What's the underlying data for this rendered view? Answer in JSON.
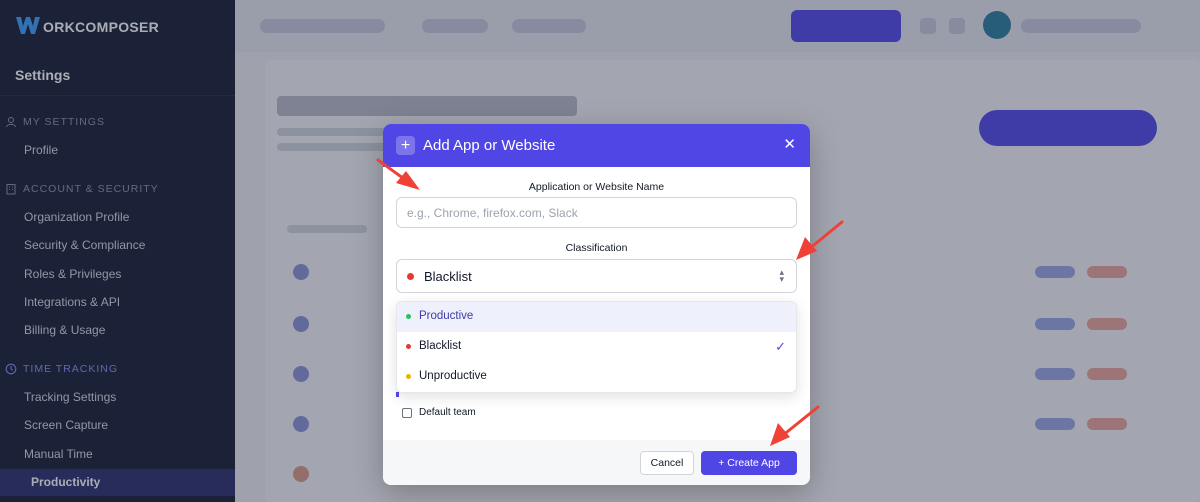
{
  "brand": {
    "logo_text": "ORKCOMPOSER",
    "logo_icon": "w-logo-icon"
  },
  "sidebar": {
    "title": "Settings",
    "sections": [
      {
        "label": "MY SETTINGS",
        "icon": "user-icon",
        "items": [
          "Profile"
        ]
      },
      {
        "label": "ACCOUNT & SECURITY",
        "icon": "building-icon",
        "items": [
          "Organization Profile",
          "Security & Compliance",
          "Roles & Privileges",
          "Integrations & API",
          "Billing & Usage"
        ]
      },
      {
        "label": "TIME TRACKING",
        "icon": "clock-icon",
        "items": [
          "Tracking Settings",
          "Screen Capture",
          "Manual Time"
        ]
      }
    ],
    "active_item": "Productivity"
  },
  "modal": {
    "title": "Add App or Website",
    "close_icon": "close-icon",
    "name_label": "Application or Website Name",
    "name_placeholder": "e.g., Chrome, firefox.com, Slack",
    "name_value": "",
    "classification_label": "Classification",
    "selected": {
      "label": "Blacklist",
      "color": "#e53935"
    },
    "options": [
      {
        "label": "Productive",
        "color": "#22c55e",
        "hovered": true,
        "selected": false
      },
      {
        "label": "Blacklist",
        "color": "#e53935",
        "hovered": false,
        "selected": true
      },
      {
        "label": "Unproductive",
        "color": "#eab308",
        "hovered": false,
        "selected": false
      }
    ],
    "default_team_label": "Default team",
    "default_team_checked": false,
    "cancel_label": "Cancel",
    "create_label": "+ Create App"
  },
  "colors": {
    "accent": "#4f46e5",
    "sidebar_bg": "#171d33",
    "annotation_arrow": "#ef4136"
  }
}
